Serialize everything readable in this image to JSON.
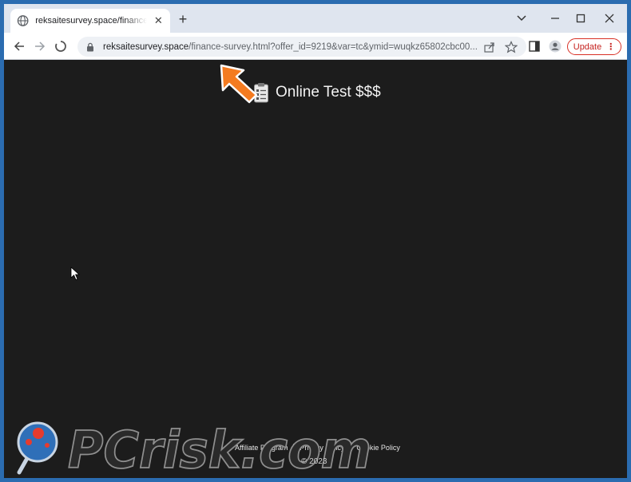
{
  "browser": {
    "tab_title": "reksaitesurvey.space/finance-survey.html",
    "tab_close": "✕",
    "new_tab": "+",
    "url_host": "reksaitesurvey.space",
    "url_path": "/finance-survey.html?offer_id=9219&var=tc&ymid=wuqkz65802cbc00...",
    "update_label": "Update",
    "update_menu": "⋮"
  },
  "page": {
    "heading": "Online Test $$$",
    "footer_links": [
      "Affiliate Program",
      "Privacy Policy",
      "Cookie Policy"
    ],
    "copyright": "© 2023"
  },
  "watermark": {
    "brand": "PCrisk.com"
  },
  "colors": {
    "page_bg": "#1c1c1c",
    "arrow": "#f47b20",
    "update": "#d93025"
  }
}
